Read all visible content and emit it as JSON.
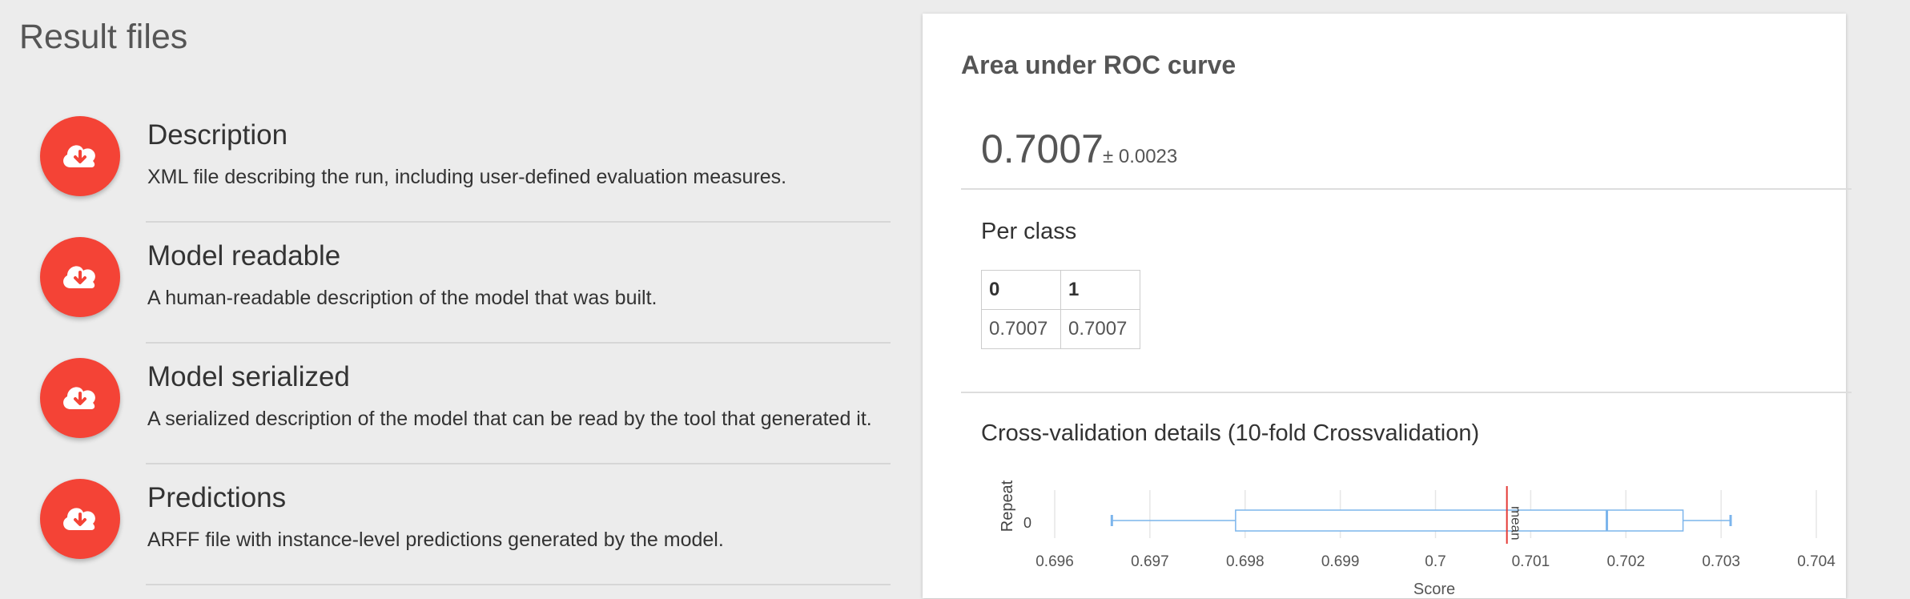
{
  "left_panel": {
    "title": "Result files",
    "files": [
      {
        "name": "Description",
        "description": "XML file describing the run, including user-defined evaluation measures.",
        "icon": "cloud-download-icon"
      },
      {
        "name": "Model readable",
        "description": "A human-readable description of the model that was built.",
        "icon": "cloud-download-icon"
      },
      {
        "name": "Model serialized",
        "description": "A serialized description of the model that can be read by the tool that generated it.",
        "icon": "cloud-download-icon"
      },
      {
        "name": "Predictions",
        "description": "ARFF file with instance-level predictions generated by the model.",
        "icon": "cloud-download-icon"
      }
    ]
  },
  "card": {
    "title": "Area under ROC curve",
    "value": "0.7007",
    "std": "± 0.0023",
    "per_class_title": "Per class",
    "per_class": {
      "headers": [
        "0",
        "1"
      ],
      "values": [
        "0.7007",
        "0.7007"
      ]
    },
    "cv_title": "Cross-validation details (10-fold Crossvalidation)"
  },
  "colors": {
    "icon_bg": "#f44336",
    "box_stroke": "#7cb5ec",
    "mean_line": "#e53935"
  },
  "chart_data": {
    "type": "boxplot",
    "orientation": "horizontal",
    "xlabel": "Score",
    "ylabel": "Repeat",
    "categories": [
      "0"
    ],
    "x_ticks": [
      "0.696",
      "0.697",
      "0.698",
      "0.699",
      "0.7",
      "0.701",
      "0.702",
      "0.703",
      "0.704"
    ],
    "xlim": [
      0.696,
      0.704
    ],
    "grid": true,
    "series": [
      {
        "low": 0.6966,
        "q1": 0.6979,
        "median": 0.7018,
        "q3": 0.7026,
        "high": 0.7031,
        "mean": 0.70075,
        "mean_label": "mean"
      }
    ]
  }
}
